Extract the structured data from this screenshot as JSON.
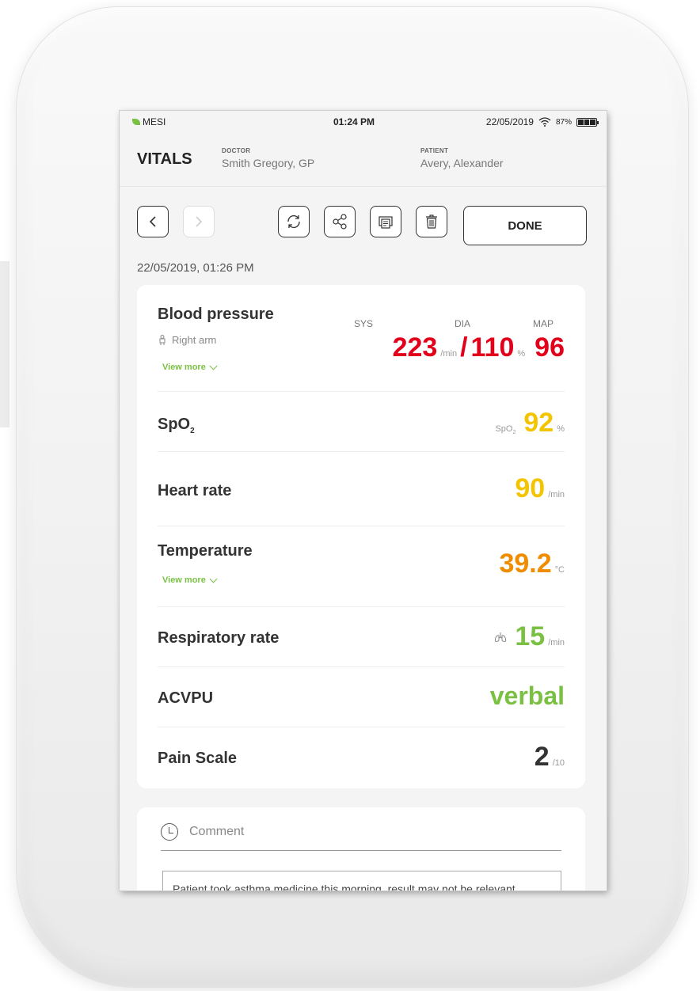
{
  "statusbar": {
    "brand": "MESI",
    "time": "01:24 PM",
    "date": "22/05/2019",
    "battery": "87%"
  },
  "header": {
    "title": "VITALS",
    "doctor_label": "DOCTOR",
    "doctor_name": "Smith Gregory, GP",
    "patient_label": "PATIENT",
    "patient_name": "Avery, Alexander"
  },
  "toolbar": {
    "done_label": "DONE"
  },
  "measurement_datetime": "22/05/2019, 01:26 PM",
  "vitals": {
    "blood_pressure": {
      "name": "Blood pressure",
      "location": "Right arm",
      "view_more": "View more",
      "sys_label": "SYS",
      "dia_label": "DIA",
      "map_label": "MAP",
      "sys": "223",
      "sys_unit": "/min",
      "separator": "/",
      "dia": "110",
      "dia_unit": "%",
      "map": "96",
      "color": "#e3001b"
    },
    "spo2": {
      "name_main": "SpO",
      "name_sub": "2",
      "label_main": "SpO",
      "label_sub": "2",
      "value": "92",
      "unit": "%",
      "color": "#f2c500"
    },
    "heart_rate": {
      "name": "Heart rate",
      "value": "90",
      "unit": "/min",
      "color": "#f2c500"
    },
    "temperature": {
      "name": "Temperature",
      "view_more": "View more",
      "value": "39.2",
      "unit": "°C",
      "color": "#f08c00"
    },
    "respiratory_rate": {
      "name": "Respiratory rate",
      "value": "15",
      "unit": "/min",
      "color": "#7ac143"
    },
    "acvpu": {
      "name": "ACVPU",
      "value": "verbal",
      "color": "#7ac143"
    },
    "pain_scale": {
      "name": "Pain Scale",
      "value": "2",
      "unit": "/10"
    }
  },
  "comment": {
    "label": "Comment",
    "text": "Patient took asthma medicine this morning, result may not be relevant."
  }
}
